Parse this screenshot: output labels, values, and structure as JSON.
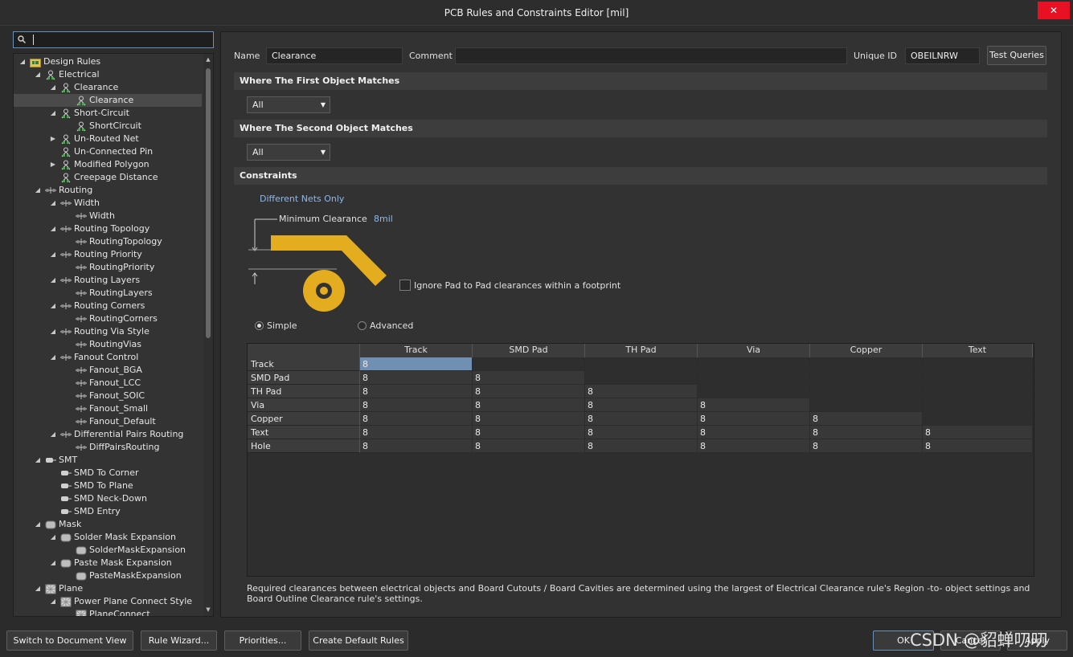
{
  "window": {
    "title": "PCB Rules and Constraints Editor [mil]",
    "close_glyph": "✕"
  },
  "search": {
    "value": ""
  },
  "tree": [
    {
      "label": "Design Rules",
      "level": 0,
      "arrow": "open",
      "icon": "rules-folder-icon"
    },
    {
      "label": "Electrical",
      "level": 1,
      "arrow": "open",
      "icon": "electrical-icon"
    },
    {
      "label": "Clearance",
      "level": 2,
      "arrow": "open",
      "icon": "electrical-icon"
    },
    {
      "label": "Clearance",
      "level": 3,
      "arrow": "none",
      "icon": "electrical-icon",
      "selected": true
    },
    {
      "label": "Short-Circuit",
      "level": 2,
      "arrow": "open",
      "icon": "electrical-icon"
    },
    {
      "label": "ShortCircuit",
      "level": 3,
      "arrow": "none",
      "icon": "electrical-icon"
    },
    {
      "label": "Un-Routed Net",
      "level": 2,
      "arrow": "closed",
      "icon": "electrical-icon"
    },
    {
      "label": "Un-Connected Pin",
      "level": 2,
      "arrow": "none",
      "icon": "electrical-icon"
    },
    {
      "label": "Modified Polygon",
      "level": 2,
      "arrow": "closed",
      "icon": "electrical-icon"
    },
    {
      "label": "Creepage Distance",
      "level": 2,
      "arrow": "none",
      "icon": "electrical-icon"
    },
    {
      "label": "Routing",
      "level": 1,
      "arrow": "open",
      "icon": "routing-icon"
    },
    {
      "label": "Width",
      "level": 2,
      "arrow": "open",
      "icon": "routing-icon"
    },
    {
      "label": "Width",
      "level": 3,
      "arrow": "none",
      "icon": "routing-icon"
    },
    {
      "label": "Routing Topology",
      "level": 2,
      "arrow": "open",
      "icon": "routing-icon"
    },
    {
      "label": "RoutingTopology",
      "level": 3,
      "arrow": "none",
      "icon": "routing-icon"
    },
    {
      "label": "Routing Priority",
      "level": 2,
      "arrow": "open",
      "icon": "routing-icon"
    },
    {
      "label": "RoutingPriority",
      "level": 3,
      "arrow": "none",
      "icon": "routing-icon"
    },
    {
      "label": "Routing Layers",
      "level": 2,
      "arrow": "open",
      "icon": "routing-icon"
    },
    {
      "label": "RoutingLayers",
      "level": 3,
      "arrow": "none",
      "icon": "routing-icon"
    },
    {
      "label": "Routing Corners",
      "level": 2,
      "arrow": "open",
      "icon": "routing-icon"
    },
    {
      "label": "RoutingCorners",
      "level": 3,
      "arrow": "none",
      "icon": "routing-icon"
    },
    {
      "label": "Routing Via Style",
      "level": 2,
      "arrow": "open",
      "icon": "routing-icon"
    },
    {
      "label": "RoutingVias",
      "level": 3,
      "arrow": "none",
      "icon": "routing-icon"
    },
    {
      "label": "Fanout Control",
      "level": 2,
      "arrow": "open",
      "icon": "routing-icon"
    },
    {
      "label": "Fanout_BGA",
      "level": 3,
      "arrow": "none",
      "icon": "routing-icon"
    },
    {
      "label": "Fanout_LCC",
      "level": 3,
      "arrow": "none",
      "icon": "routing-icon"
    },
    {
      "label": "Fanout_SOIC",
      "level": 3,
      "arrow": "none",
      "icon": "routing-icon"
    },
    {
      "label": "Fanout_Small",
      "level": 3,
      "arrow": "none",
      "icon": "routing-icon"
    },
    {
      "label": "Fanout_Default",
      "level": 3,
      "arrow": "none",
      "icon": "routing-icon"
    },
    {
      "label": "Differential Pairs Routing",
      "level": 2,
      "arrow": "open",
      "icon": "routing-icon"
    },
    {
      "label": "DiffPairsRouting",
      "level": 3,
      "arrow": "none",
      "icon": "routing-icon"
    },
    {
      "label": "SMT",
      "level": 1,
      "arrow": "open",
      "icon": "smt-icon"
    },
    {
      "label": "SMD To Corner",
      "level": 2,
      "arrow": "none",
      "icon": "smt-icon"
    },
    {
      "label": "SMD To Plane",
      "level": 2,
      "arrow": "none",
      "icon": "smt-icon"
    },
    {
      "label": "SMD Neck-Down",
      "level": 2,
      "arrow": "none",
      "icon": "smt-icon"
    },
    {
      "label": "SMD Entry",
      "level": 2,
      "arrow": "none",
      "icon": "smt-icon"
    },
    {
      "label": "Mask",
      "level": 1,
      "arrow": "open",
      "icon": "mask-icon"
    },
    {
      "label": "Solder Mask Expansion",
      "level": 2,
      "arrow": "open",
      "icon": "mask-icon"
    },
    {
      "label": "SolderMaskExpansion",
      "level": 3,
      "arrow": "none",
      "icon": "mask-icon"
    },
    {
      "label": "Paste Mask Expansion",
      "level": 2,
      "arrow": "open",
      "icon": "mask-icon"
    },
    {
      "label": "PasteMaskExpansion",
      "level": 3,
      "arrow": "none",
      "icon": "mask-icon"
    },
    {
      "label": "Plane",
      "level": 1,
      "arrow": "open",
      "icon": "plane-icon"
    },
    {
      "label": "Power Plane Connect Style",
      "level": 2,
      "arrow": "open",
      "icon": "plane-icon"
    },
    {
      "label": "PlaneConnect",
      "level": 3,
      "arrow": "none",
      "icon": "plane-icon"
    }
  ],
  "rule": {
    "name_label": "Name",
    "name_value": "Clearance",
    "comment_label": "Comment",
    "comment_value": "",
    "uid_label": "Unique ID",
    "uid_value": "OBEILNRW",
    "test_queries": "Test Queries"
  },
  "first_match": {
    "title": "Where The First Object Matches",
    "value": "All"
  },
  "second_match": {
    "title": "Where The Second Object Matches",
    "value": "All"
  },
  "constraints": {
    "title": "Constraints",
    "net_scope": "Different Nets Only",
    "min_clearance_label": "Minimum Clearance",
    "min_clearance_value": "8mil",
    "ignore_pad_label": "Ignore Pad to Pad clearances within a footprint",
    "ignore_pad_checked": false,
    "mode_simple": "Simple",
    "mode_advanced": "Advanced",
    "mode_selected": "Simple",
    "accent_color": "#e4ad1f"
  },
  "matrix": {
    "columns": [
      "Track",
      "SMD Pad",
      "TH Pad",
      "Via",
      "Copper",
      "Text"
    ],
    "rows": [
      {
        "label": "Track",
        "values": [
          "8",
          "",
          "",
          "",
          "",
          ""
        ]
      },
      {
        "label": "SMD Pad",
        "values": [
          "8",
          "8",
          "",
          "",
          "",
          ""
        ]
      },
      {
        "label": "TH Pad",
        "values": [
          "8",
          "8",
          "8",
          "",
          "",
          ""
        ]
      },
      {
        "label": "Via",
        "values": [
          "8",
          "8",
          "8",
          "8",
          "",
          ""
        ]
      },
      {
        "label": "Copper",
        "values": [
          "8",
          "8",
          "8",
          "8",
          "8",
          ""
        ]
      },
      {
        "label": "Text",
        "values": [
          "8",
          "8",
          "8",
          "8",
          "8",
          "8"
        ]
      },
      {
        "label": "Hole",
        "values": [
          "8",
          "8",
          "8",
          "8",
          "8",
          "8"
        ]
      }
    ]
  },
  "footnote": "Required clearances between electrical objects and Board Cutouts / Board Cavities are determined using the largest of Electrical Clearance rule's Region -to- object settings and Board Outline Clearance rule's settings.",
  "bottom": {
    "switch_view": "Switch to Document View",
    "rule_wizard": "Rule Wizard...",
    "priorities": "Priorities...",
    "create_defaults": "Create Default Rules",
    "ok": "OK",
    "cancel": "Cancel",
    "apply": "Apply"
  },
  "watermark": "CSDN @貂蝉叨叨"
}
